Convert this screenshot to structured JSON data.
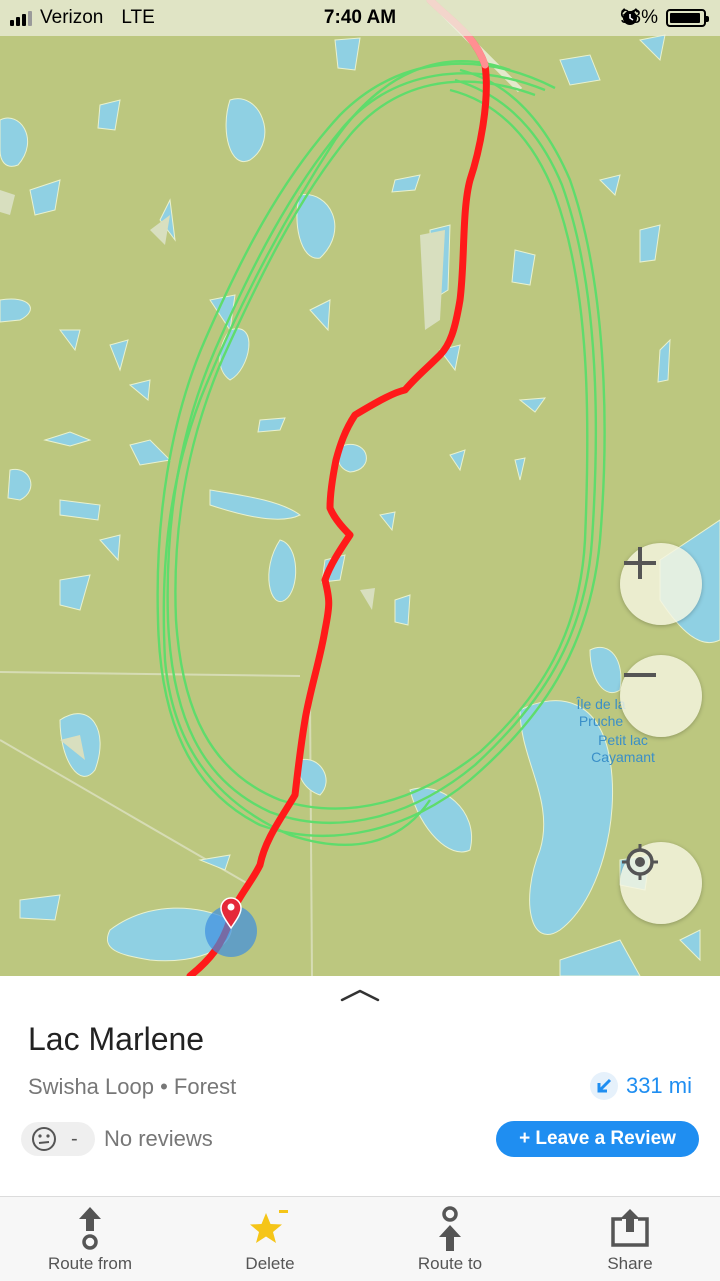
{
  "status_bar": {
    "carrier": "Verizon",
    "network": "LTE",
    "time": "7:40 AM",
    "battery": "93%",
    "battery_level": 0.93,
    "icons": [
      "location-arrow-icon",
      "alarm-icon",
      "battery-icon"
    ]
  },
  "map": {
    "labels": {
      "ile": "Île de la Pruche",
      "petit_lac": "Petit lac Cayamant"
    },
    "controls": {
      "zoom_in": "+",
      "zoom_out": "−",
      "locate_icon": "crosshair-icon"
    },
    "colors": {
      "land": "#bcc77f",
      "water": "#8fd0e3",
      "route": "#ff1a1a",
      "loop": "#5fdc6c"
    }
  },
  "place": {
    "title": "Lac Marlene",
    "subtitle": "Swisha Loop • Forest",
    "distance": "331 mi",
    "rating": "-",
    "reviews": "No reviews",
    "review_button": "+ Leave a Review"
  },
  "tabbar": {
    "items": [
      {
        "label": "Route from",
        "icon": "route-from-icon"
      },
      {
        "label": "Delete",
        "icon": "star-icon"
      },
      {
        "label": "Route to",
        "icon": "route-to-icon"
      },
      {
        "label": "Share",
        "icon": "share-icon"
      }
    ]
  },
  "colors": {
    "accent": "#1f8ef1",
    "star": "#f5c518"
  }
}
